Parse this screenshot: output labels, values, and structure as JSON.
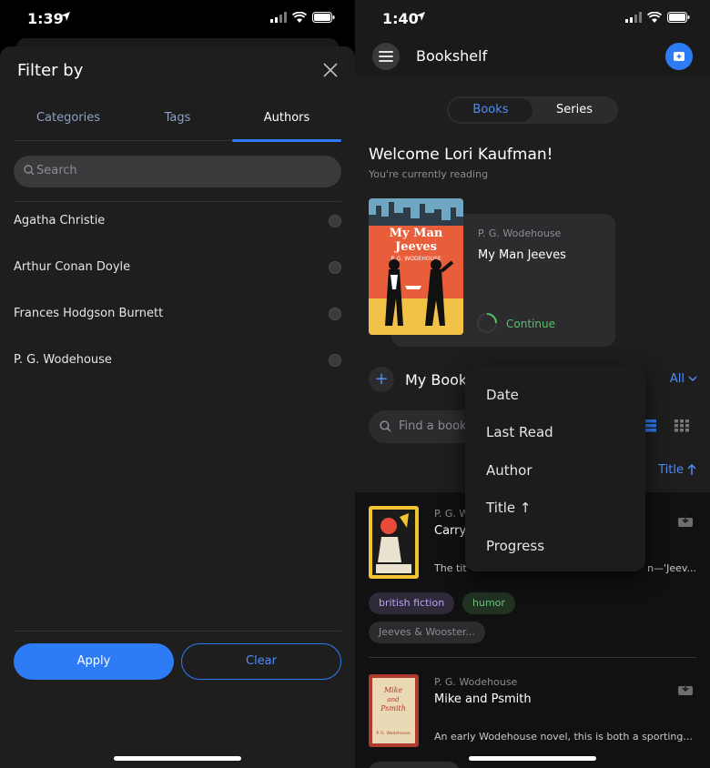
{
  "colors": {
    "accent": "#2d7cf6",
    "continue": "#58c067",
    "bg": "#1e1e1f"
  },
  "left": {
    "status": {
      "time": "1:39"
    },
    "sheet": {
      "title": "Filter by",
      "tabs": [
        {
          "label": "Categories",
          "active": false
        },
        {
          "label": "Tags",
          "active": false
        },
        {
          "label": "Authors",
          "active": true
        }
      ],
      "search_placeholder": "Search",
      "authors": [
        {
          "name": "Agatha Christie",
          "selected": false
        },
        {
          "name": "Arthur Conan Doyle",
          "selected": false
        },
        {
          "name": "Frances Hodgson Burnett",
          "selected": false
        },
        {
          "name": "P. G. Wodehouse",
          "selected": false
        }
      ],
      "apply_label": "Apply",
      "clear_label": "Clear"
    }
  },
  "right": {
    "status": {
      "time": "1:40"
    },
    "appbar": {
      "title": "Bookshelf"
    },
    "segment": {
      "books": "Books",
      "series": "Series",
      "active": "Books"
    },
    "welcome": "Welcome Lori Kaufman!",
    "reading_label": "You're currently reading",
    "current": {
      "author": "P. G. Wodehouse",
      "title": "My Man Jeeves",
      "cover_title": "My Man Jeeves",
      "cover_author": "P. G. WODEHOUSE",
      "continue_label": "Continue"
    },
    "mybooks": {
      "title": "My Book",
      "filter": "All",
      "find_placeholder": "Find a book",
      "sort_label": "Title"
    },
    "sort_menu": [
      "Date",
      "Last Read",
      "Author",
      "Title ↑",
      "Progress"
    ],
    "books": [
      {
        "author": "P. G. W",
        "title": "Carry",
        "desc_start": "The tit",
        "desc_end": "n—'Jeev...",
        "tags": [
          "british fiction",
          "humor",
          "Jeeves & Wooster..."
        ]
      },
      {
        "author": "P. G. Wodehouse",
        "title": "Mike and Psmith",
        "cover_title": "Mike and Psmith",
        "cover_author": "P. G. Wodehouse",
        "desc": "An early Wodehouse novel, this is both a sporting...",
        "tags": []
      }
    ]
  }
}
